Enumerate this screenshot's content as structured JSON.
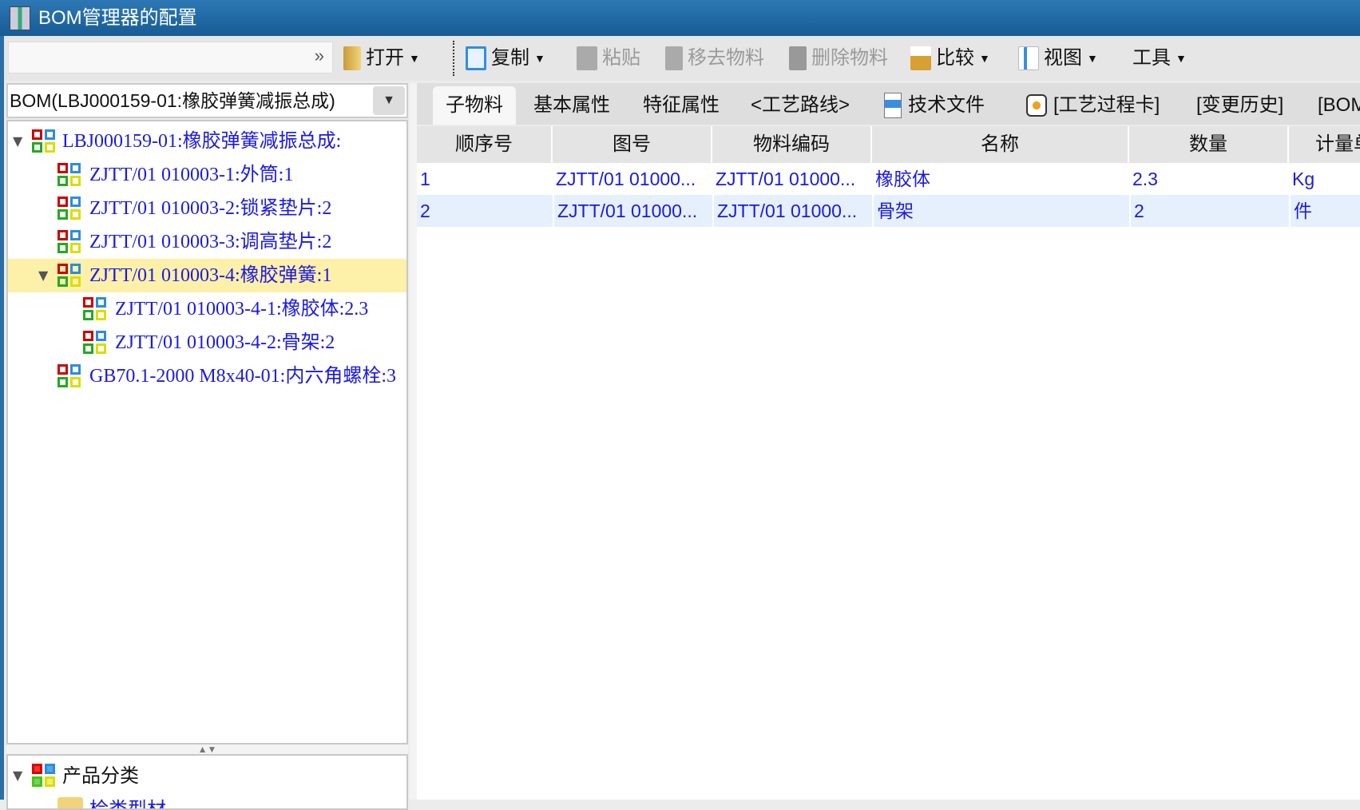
{
  "window": {
    "title": "BOM管理器的配置"
  },
  "toolbar": {
    "search_value": "",
    "items": [
      {
        "label": "打开",
        "icon": "folder-icon",
        "enabled": true,
        "dropdown": true
      },
      {
        "label": "复制",
        "icon": "copy-icon",
        "enabled": true,
        "dropdown": true
      },
      {
        "label": "粘贴",
        "icon": "paste-icon",
        "enabled": false
      },
      {
        "label": "移去物料",
        "icon": "remove-icon",
        "enabled": false
      },
      {
        "label": "删除物料",
        "icon": "trash-icon",
        "enabled": false
      },
      {
        "label": "比较",
        "icon": "scale-icon",
        "enabled": true,
        "dropdown": true
      },
      {
        "label": "视图",
        "icon": "view-icon",
        "enabled": true,
        "dropdown": true
      },
      {
        "label": "工具",
        "enabled": true,
        "dropdown": true
      }
    ]
  },
  "left": {
    "bom_select": "BOM(LBJ000159-01:橡胶弹簧减振总成)",
    "tree": [
      {
        "label": "LBJ000159-01:橡胶弹簧减振总成:",
        "level": 0,
        "expanded": true
      },
      {
        "label": "ZJTT/01 010003-1:外筒:1",
        "level": 1
      },
      {
        "label": "ZJTT/01 010003-2:锁紧垫片:2",
        "level": 1
      },
      {
        "label": "ZJTT/01 010003-3:调高垫片:2",
        "level": 1
      },
      {
        "label": "ZJTT/01 010003-4:橡胶弹簧:1",
        "level": 1,
        "expanded": true,
        "selected": true
      },
      {
        "label": "ZJTT/01 010003-4-1:橡胶体:2.3",
        "level": 2
      },
      {
        "label": "ZJTT/01 010003-4-2:骨架:2",
        "level": 2
      },
      {
        "label": "GB70.1-2000 M8x40-01:内六角螺栓:3",
        "level": 1
      }
    ],
    "category_tree": {
      "root": "产品分类",
      "child": "检类型材"
    }
  },
  "tabs": [
    "子物料",
    "基本属性",
    "特征属性",
    "<工艺路线>",
    "技术文件",
    "[工艺过程卡]",
    "[变更历史]",
    "[BOM"
  ],
  "table": {
    "columns": [
      "顺序号",
      "图号",
      "物料编码",
      "名称",
      "数量",
      "计量单"
    ],
    "rows": [
      [
        "1",
        "ZJTT/01 01000...",
        "ZJTT/01 01000...",
        "橡胶体",
        "2.3",
        "Kg"
      ],
      [
        "2",
        "ZJTT/01 01000...",
        "ZJTT/01 01000...",
        "骨架",
        "2",
        "件"
      ]
    ]
  }
}
